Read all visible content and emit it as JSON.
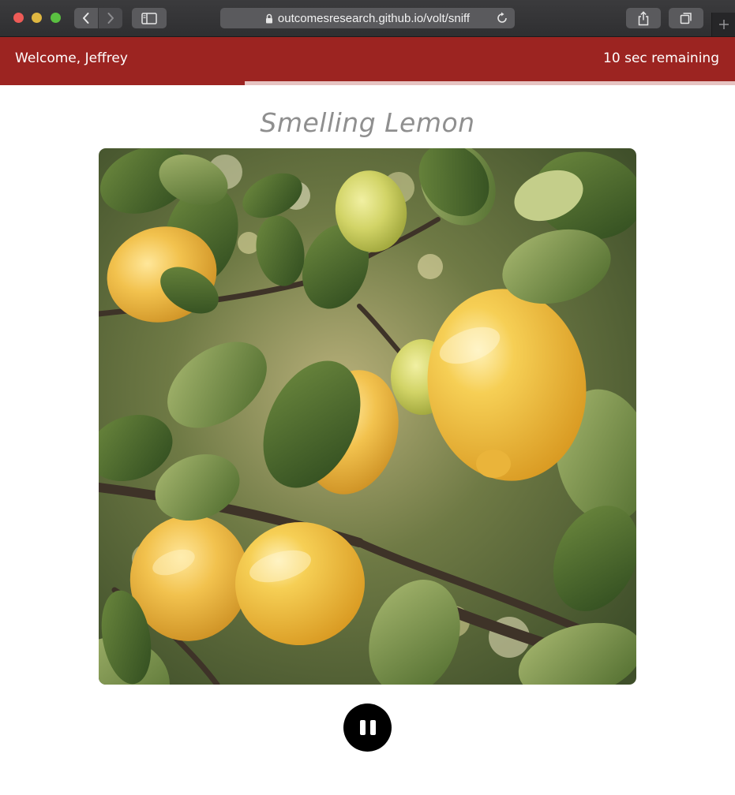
{
  "browser": {
    "url": "outcomesresearch.github.io/volt/sniff",
    "icons": {
      "back": "chevron-left-icon",
      "forward": "chevron-right-icon",
      "sidebar": "sidebar-icon",
      "lock": "lock-icon",
      "reload": "reload-icon",
      "share": "share-icon",
      "tabs": "tabs-overview-icon",
      "new_tab": "plus-icon"
    }
  },
  "header": {
    "welcome": "Welcome, Jeffrey",
    "remaining": "10 sec remaining",
    "color": "#9c2421",
    "progress_fraction": 0.667
  },
  "main": {
    "title": "Smelling Lemon",
    "image_subject": "lemons on a tree branch",
    "pause_icon": "pause-icon"
  }
}
